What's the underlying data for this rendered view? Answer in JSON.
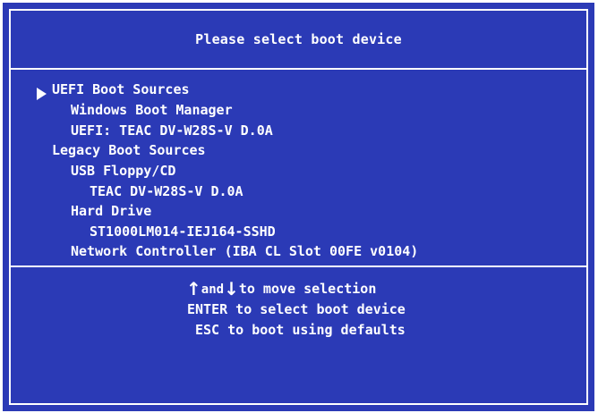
{
  "header": {
    "title": "Please select boot device"
  },
  "menu": {
    "items": [
      {
        "label": "UEFI Boot Sources",
        "level": 0,
        "selected": true
      },
      {
        "label": "Windows Boot Manager",
        "level": 1
      },
      {
        "label": "UEFI: TEAC DV-W28S-V D.0A",
        "level": 1
      },
      {
        "label": "Legacy Boot Sources",
        "level": 0
      },
      {
        "label": "USB Floppy/CD",
        "level": 1
      },
      {
        "label": "TEAC DV-W28S-V D.0A",
        "level": 2
      },
      {
        "label": "Hard Drive",
        "level": 1
      },
      {
        "label": "ST1000LM014-IEJ164-SSHD",
        "level": 2
      },
      {
        "label": "Network Controller (IBA CL Slot 00FE v0104)",
        "level": 1
      }
    ]
  },
  "help": {
    "up_arrow": "↑",
    "and_text": "and",
    "down_arrow": "↓",
    "move_text": "to move selection",
    "enter_text": "ENTER to select boot device",
    "esc_text": "ESC to boot using defaults"
  },
  "colors": {
    "background": "#2b3ab6",
    "text": "#ffffff"
  },
  "icons": {
    "pointer": "triangle-right-icon",
    "up": "arrow-up-icon",
    "down": "arrow-down-icon"
  }
}
